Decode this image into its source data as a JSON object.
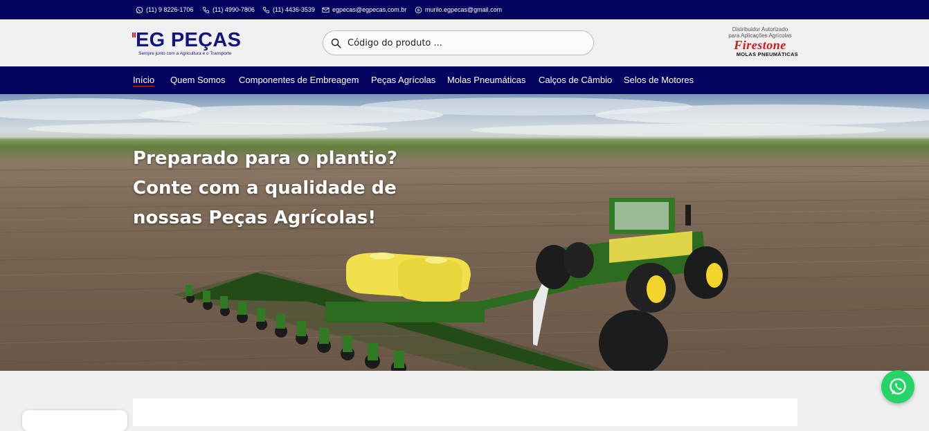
{
  "topbar": {
    "contacts": [
      {
        "icon": "whatsapp-icon",
        "text": "(11) 9 8226-1706"
      },
      {
        "icon": "phone-icon",
        "text": "(11) 4990-7806"
      },
      {
        "icon": "phone-icon",
        "text": "(11) 4436-3539"
      },
      {
        "icon": "email-icon",
        "text": "egpecas@egpecas.com.br"
      },
      {
        "icon": "skype-icon",
        "text": "murilo.egpecas@gmail.com"
      }
    ]
  },
  "header": {
    "logo": {
      "title": "EG PEÇAS",
      "tagline": "Sempre junto com a Agricultura e o Transporte"
    },
    "search": {
      "placeholder": "Código do produto ...",
      "value": ""
    },
    "partner": {
      "line1": "Distribuidor Autorizado",
      "line2": "para Aplicações Agrícolas",
      "brand": "Firestone",
      "sub": "MOLAS PNEUMÁTICAS"
    }
  },
  "nav": {
    "items": [
      {
        "label": "Início",
        "active": true
      },
      {
        "label": "Quem Somos"
      },
      {
        "label": "Componentes de Embreagem"
      },
      {
        "label": "Peças Agrícolas"
      },
      {
        "label": "Molas Pneumáticas"
      },
      {
        "label": "Calços de Câmbio"
      },
      {
        "label": "Selos de Motores"
      }
    ]
  },
  "hero": {
    "lines": [
      "Preparado para o plantio?",
      "Conte com a qualidade de",
      "nossas Peças Agrícolas!"
    ]
  },
  "colors": {
    "navy": "#04045e",
    "brand_blue": "#13137e",
    "firestone_red": "#d8141a",
    "whatsapp_green": "#25d366",
    "tractor_green": "#2d6b1f",
    "tractor_yellow": "#f1e04c"
  },
  "floating": {
    "icon": "whatsapp-icon"
  }
}
